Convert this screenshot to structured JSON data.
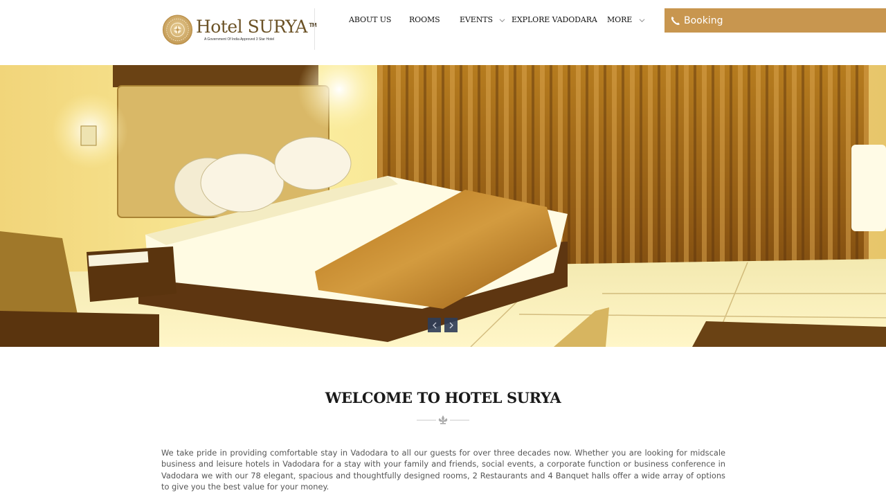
{
  "brand": {
    "name": "Hotel SURYA",
    "trademark": "TM",
    "tagline": "A Government Of India Approved 3 Star Hotel",
    "accent_color": "#c8964f",
    "logo_icon": "sun-emblem-icon"
  },
  "nav": {
    "items": [
      {
        "label": "ABOUT US",
        "has_dropdown": false
      },
      {
        "label": "ROOMS",
        "has_dropdown": false
      },
      {
        "label": "EVENTS",
        "has_dropdown": true
      },
      {
        "label": "EXPLORE VADODARA",
        "has_dropdown": false
      },
      {
        "label": "MORE",
        "has_dropdown": true
      }
    ],
    "booking_label": "Booking",
    "booking_icon": "phone-icon"
  },
  "hero": {
    "image_subject": "hotel-room-bed",
    "prev_icon": "chevron-left-icon",
    "next_icon": "chevron-right-icon"
  },
  "welcome": {
    "title": "WELCOME TO HOTEL SURYA",
    "ornament_icon": "fleur-de-lis-icon",
    "body": "We take pride in providing comfortable stay in Vadodara to all our guests for over three decades now. Whether you are looking for midscale business and leisure hotels in Vadodara for a stay with your family and friends, social events, a corporate function or business conference in Vadodara we with our 78 elegant, spacious and thoughtfully designed rooms, 2 Restaurants and 4 Banquet halls offer a wide array of options to give you the best value for your money."
  }
}
